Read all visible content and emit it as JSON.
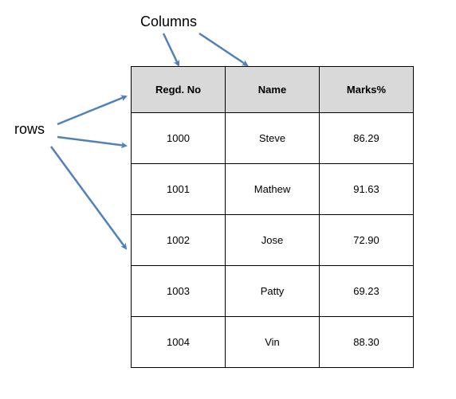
{
  "labels": {
    "columns": "Columns",
    "rows": "rows"
  },
  "table": {
    "headers": {
      "regd_no": "Regd. No",
      "name": "Name",
      "marks": "Marks%"
    },
    "rows": [
      {
        "regd_no": "1000",
        "name": "Steve",
        "marks": "86.29"
      },
      {
        "regd_no": "1001",
        "name": "Mathew",
        "marks": "91.63"
      },
      {
        "regd_no": "1002",
        "name": "Jose",
        "marks": "72.90"
      },
      {
        "regd_no": "1003",
        "name": "Patty",
        "marks": "69.23"
      },
      {
        "regd_no": "1004",
        "name": "Vin",
        "marks": "88.30"
      }
    ]
  },
  "colors": {
    "arrow": "#4f81bd",
    "header_bg": "#d9d9d9"
  }
}
